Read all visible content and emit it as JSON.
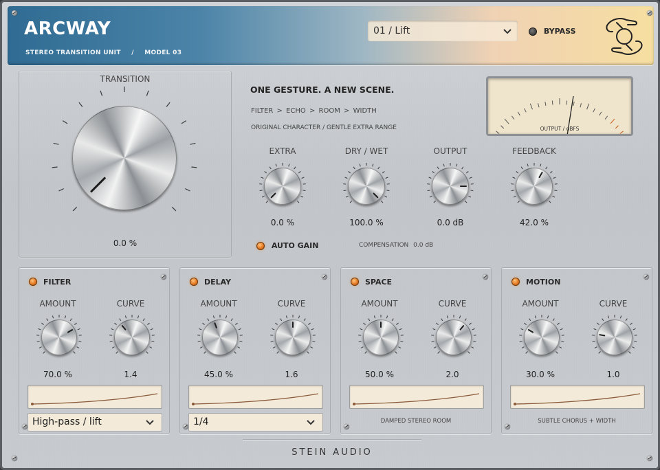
{
  "header": {
    "title": "ARCWAY",
    "subtitle_left": "STEREO TRANSITION UNIT",
    "subtitle_sep": "/",
    "subtitle_right": "MODEL 03",
    "preset": "01 / Lift",
    "bypass_label": "BYPASS",
    "logo_icon": "hands-circle-icon"
  },
  "main": {
    "transition_label": "TRANSITION",
    "transition_value": "0.0 %",
    "tagline": "ONE GESTURE. A NEW SCENE.",
    "chain": [
      "FILTER",
      ">",
      "ECHO",
      ">",
      "ROOM",
      ">",
      "WIDTH"
    ],
    "character": "ORIGINAL CHARACTER / GENTLE EXTRA RANGE",
    "meter_label": "OUTPUT / dBFS",
    "knobs": [
      {
        "label": "EXTRA",
        "value": "0.0 %"
      },
      {
        "label": "DRY / WET",
        "value": "100.0 %"
      },
      {
        "label": "OUTPUT",
        "value": "0.0 dB"
      },
      {
        "label": "FEEDBACK",
        "value": "42.0 %"
      }
    ],
    "auto_gain_label": "AUTO GAIN",
    "compensation_label": "COMPENSATION",
    "compensation_value": "0.0 dB"
  },
  "modules": [
    {
      "title": "FILTER",
      "amount_label": "AMOUNT",
      "curve_label": "CURVE",
      "amount_value": "70.0 %",
      "curve_value": "1.4",
      "footer": "High-pass / lift",
      "footer_type": "dropdown"
    },
    {
      "title": "DELAY",
      "amount_label": "AMOUNT",
      "curve_label": "CURVE",
      "amount_value": "45.0 %",
      "curve_value": "1.6",
      "footer": "1/4",
      "footer_type": "dropdown"
    },
    {
      "title": "SPACE",
      "amount_label": "AMOUNT",
      "curve_label": "CURVE",
      "amount_value": "50.0 %",
      "curve_value": "2.0",
      "footer": "DAMPED STEREO ROOM",
      "footer_type": "text"
    },
    {
      "title": "MOTION",
      "amount_label": "AMOUNT",
      "curve_label": "CURVE",
      "amount_value": "30.0 %",
      "curve_value": "1.0",
      "footer": "SUBTLE CHORUS + WIDTH",
      "footer_type": "text"
    }
  ],
  "footer": {
    "brand": "STEIN AUDIO"
  },
  "colors": {
    "accent_led": "#e2751e",
    "header_left": "#2f6b93",
    "header_right": "#f6dea0",
    "curve": "#8a5a3a"
  }
}
